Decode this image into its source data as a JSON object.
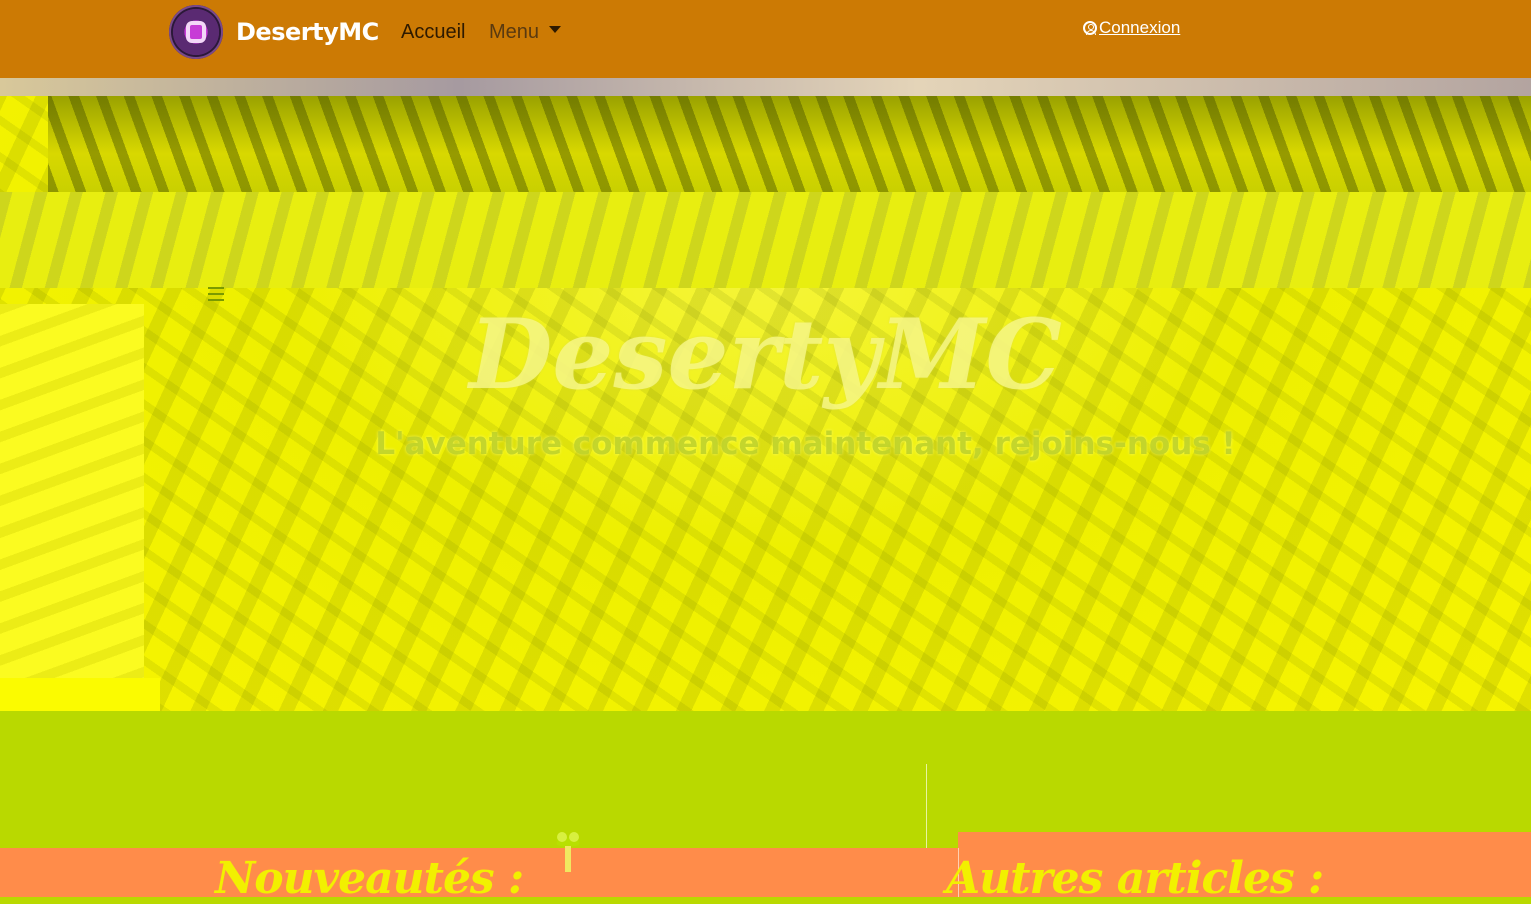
{
  "navbar": {
    "brand": "DesertyMC",
    "links": [
      {
        "label": "Accueil"
      },
      {
        "label": "Menu"
      }
    ],
    "login_label": "Connexion",
    "colors": {
      "background": "#cc7a04",
      "text": "#ffffff"
    },
    "icons": {
      "logo": "server-logo-icon",
      "login": "user-circle-icon",
      "menu": "chevron-down-icon"
    }
  },
  "hero": {
    "title": "DesertyMC",
    "subtitle": "L'aventure commence maintenant, rejoins-nous !"
  },
  "sections": {
    "news_title": "Nouveautés :",
    "articles_title": "Autres articles :",
    "news_icon": "cactus-icon"
  }
}
